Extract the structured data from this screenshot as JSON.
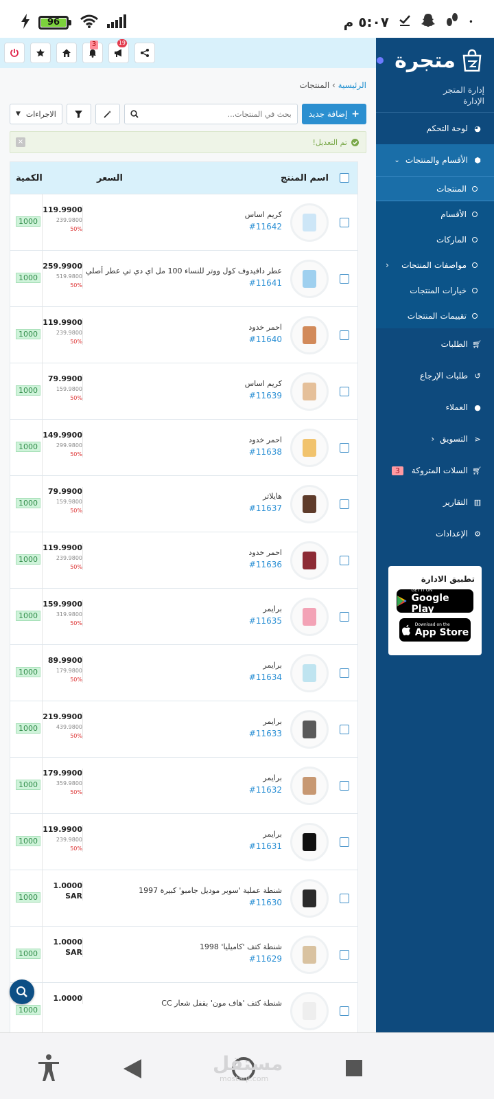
{
  "status_bar": {
    "time": "٥:٠٧ م",
    "battery_percent": "96",
    "icons": [
      "charging-icon",
      "battery-icon",
      "wifi-icon",
      "signal-icon",
      "dot-icon",
      "feet-icon",
      "snapchat-icon",
      "check-icon"
    ]
  },
  "toolbar": {
    "notification_badge": "3",
    "announce_badge": "19"
  },
  "sidebar": {
    "logo": "متجرة",
    "store_management": "إدارة المتجر",
    "admin": "الإدارة",
    "nav": [
      {
        "label": "لوحة التحكم",
        "icon": "dashboard-icon"
      },
      {
        "label": "الأقسام والمنتجات",
        "icon": "tag-icon"
      }
    ],
    "sub": [
      {
        "label": "المنتجات"
      },
      {
        "label": "الأقسام"
      },
      {
        "label": "الماركات"
      },
      {
        "label": "مواصفات المنتجات"
      },
      {
        "label": "خيارات المنتجات"
      },
      {
        "label": "تقييمات المنتجات"
      }
    ],
    "nav2": [
      {
        "label": "الطلبات",
        "icon": "cart-icon"
      },
      {
        "label": "طلبات الإرجاع",
        "icon": "undo-icon"
      },
      {
        "label": "العملاء",
        "icon": "user-icon"
      },
      {
        "label": "التسويق",
        "icon": "share-icon"
      },
      {
        "label": "السلات المتروكة",
        "icon": "cart-icon",
        "badge": "3"
      },
      {
        "label": "التقارير",
        "icon": "chart-icon"
      },
      {
        "label": "الإعدادات",
        "icon": "gear-icon"
      }
    ],
    "app_box": {
      "title": "تطبيق الادارة",
      "google_small": "GET IT ON",
      "google_big": "Google Play",
      "apple_small": "Download on the",
      "apple_big": "App Store"
    }
  },
  "breadcrumb": {
    "home": "الرئيسية",
    "sep": "›",
    "current": "المنتجات"
  },
  "actions": {
    "add_label": "إضافة جديد",
    "search_placeholder": "بحث في المنتجات...",
    "dropdown_label": "الاجراءات"
  },
  "alert": {
    "text": "تم التعديل!"
  },
  "table": {
    "headers": {
      "name": "اسم المنتج",
      "price": "السعر",
      "qty": "الكمية"
    },
    "rows": [
      {
        "name": "كريم اساس",
        "id": "#11642",
        "price": "119.9900",
        "old": "239.9800",
        "disc": "50%",
        "qty": "1000",
        "thumb": "#cde6f7"
      },
      {
        "name": "عطر دافيدوف كول ووتر للنساء 100 مل اي دي تي عطر أصلي",
        "id": "#11641",
        "price": "259.9900",
        "old": "519.9800",
        "disc": "50%",
        "qty": "1000",
        "thumb": "#9fd0ef"
      },
      {
        "name": "احمر خدود",
        "id": "#11640",
        "price": "119.9900",
        "old": "239.9800",
        "disc": "50%",
        "qty": "1000",
        "thumb": "#d28a5a"
      },
      {
        "name": "كريم اساس",
        "id": "#11639",
        "price": "79.9900",
        "old": "159.9800",
        "disc": "50%",
        "qty": "1000",
        "thumb": "#e5c09a"
      },
      {
        "name": "احمر خدود",
        "id": "#11638",
        "price": "149.9900",
        "old": "299.9800",
        "disc": "50%",
        "qty": "1000",
        "thumb": "#f1c36d"
      },
      {
        "name": "هايلاتر",
        "id": "#11637",
        "price": "79.9900",
        "old": "159.9800",
        "disc": "50%",
        "qty": "1000",
        "thumb": "#5e3b2a"
      },
      {
        "name": "احمر خدود",
        "id": "#11636",
        "price": "119.9900",
        "old": "239.9800",
        "disc": "50%",
        "qty": "1000",
        "thumb": "#8d2b35"
      },
      {
        "name": "برايمر",
        "id": "#11635",
        "price": "159.9900",
        "old": "319.9800",
        "disc": "50%",
        "qty": "1000",
        "thumb": "#f3a3b6"
      },
      {
        "name": "برايمر",
        "id": "#11634",
        "price": "89.9900",
        "old": "179.9800",
        "disc": "50%",
        "qty": "1000",
        "thumb": "#bfe4f0"
      },
      {
        "name": "برايمر",
        "id": "#11633",
        "price": "219.9900",
        "old": "439.9800",
        "disc": "50%",
        "qty": "1000",
        "thumb": "#5a5a5a"
      },
      {
        "name": "برايمر",
        "id": "#11632",
        "price": "179.9900",
        "old": "359.9800",
        "disc": "50%",
        "qty": "1000",
        "thumb": "#c79872"
      },
      {
        "name": "برايمر",
        "id": "#11631",
        "price": "119.9900",
        "old": "239.9800",
        "disc": "50%",
        "qty": "1000",
        "thumb": "#111111"
      },
      {
        "name": "شنطة عملية 'سوبر موديل جامبو' كبيرة 1997",
        "id": "#11630",
        "price": "1.0000",
        "currency": "SAR",
        "qty": "1000",
        "thumb": "#2b2b2b"
      },
      {
        "name": "شنطة كتف 'كاميليا' 1998",
        "id": "#11629",
        "price": "1.0000",
        "currency": "SAR",
        "qty": "1000",
        "thumb": "#d9c2a0"
      },
      {
        "name": "شنطة كتف 'هاف مون' بقفل شعار CC",
        "id": "",
        "price": "1.0000",
        "currency": "",
        "qty": "1000",
        "thumb": "#eeeeee"
      }
    ]
  },
  "watermark": {
    "text": "مستقل",
    "sub": "mostaql.com"
  }
}
